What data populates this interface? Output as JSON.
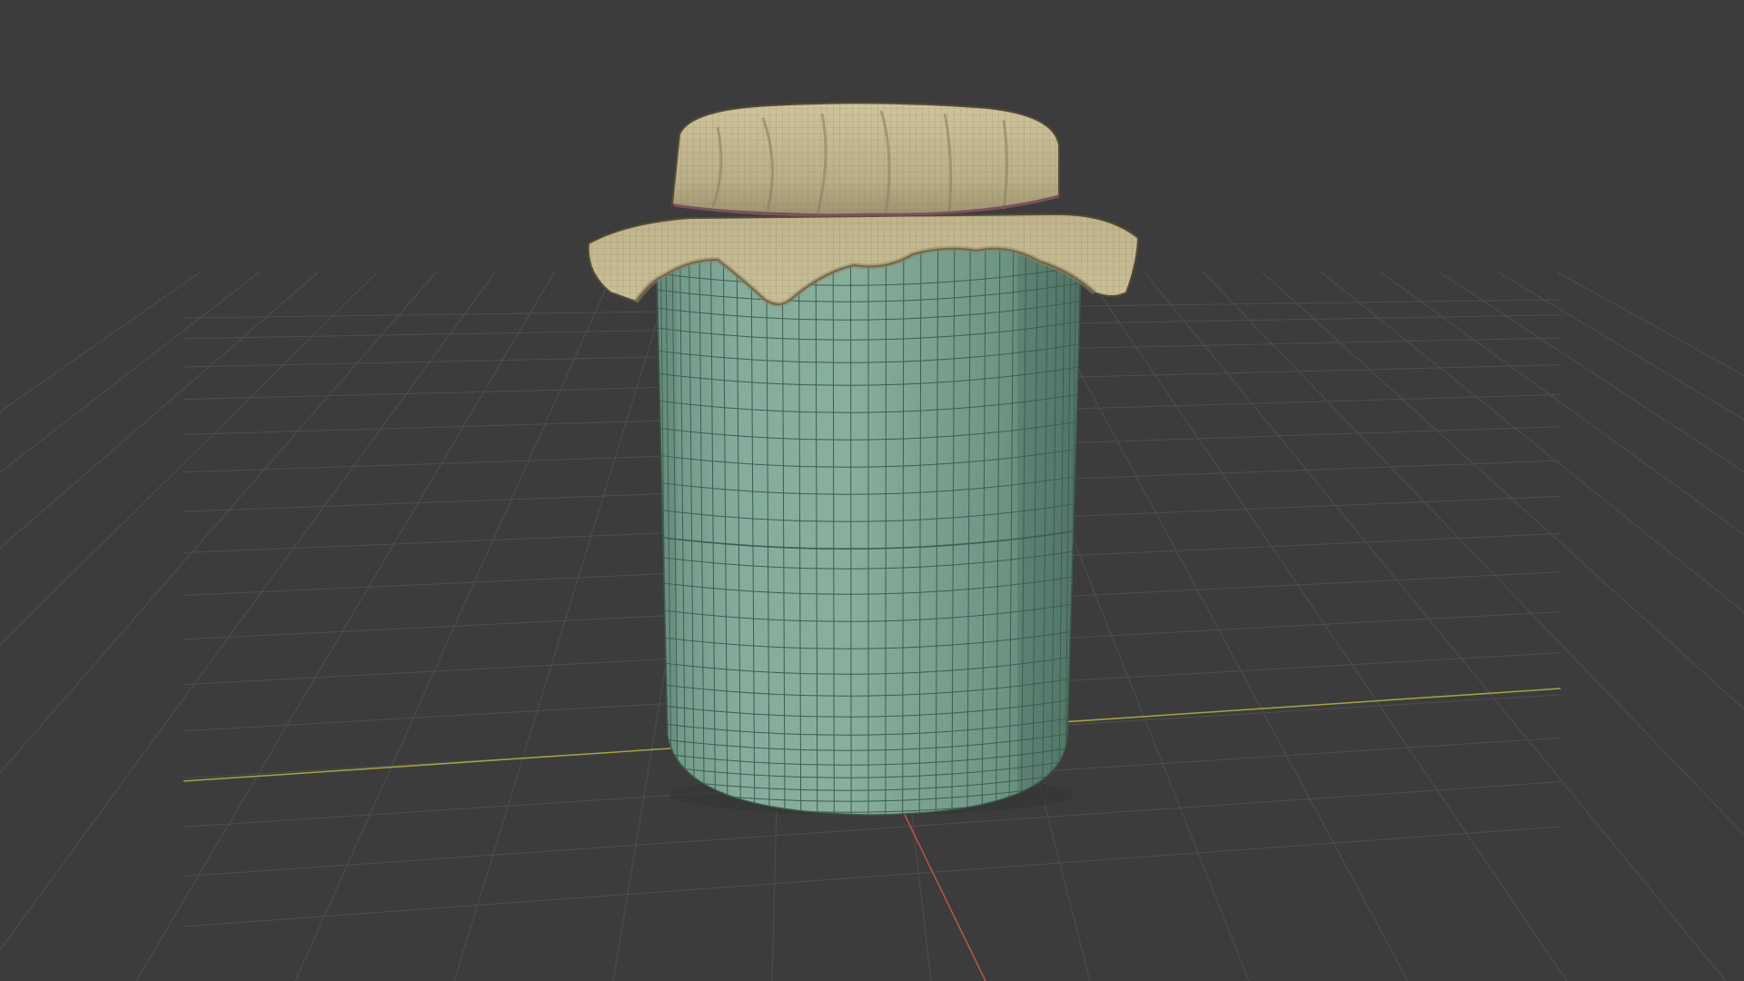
{
  "viewport": {
    "background_color": "#3c3c3c",
    "grid_color": "#4e4e4e",
    "x_axis_color": "#a7a53a",
    "y_axis_color": "#c2504e"
  },
  "object": {
    "jar_body_color": "#7ea593",
    "jar_body_shade_color": "#5d8473",
    "jar_wire_color": "#3f5d52",
    "cloth_color": "#c5bb92",
    "cloth_shade_color": "#8e8463",
    "cloth_wire_color": "#6c6548",
    "string_color": "#7d5060"
  }
}
